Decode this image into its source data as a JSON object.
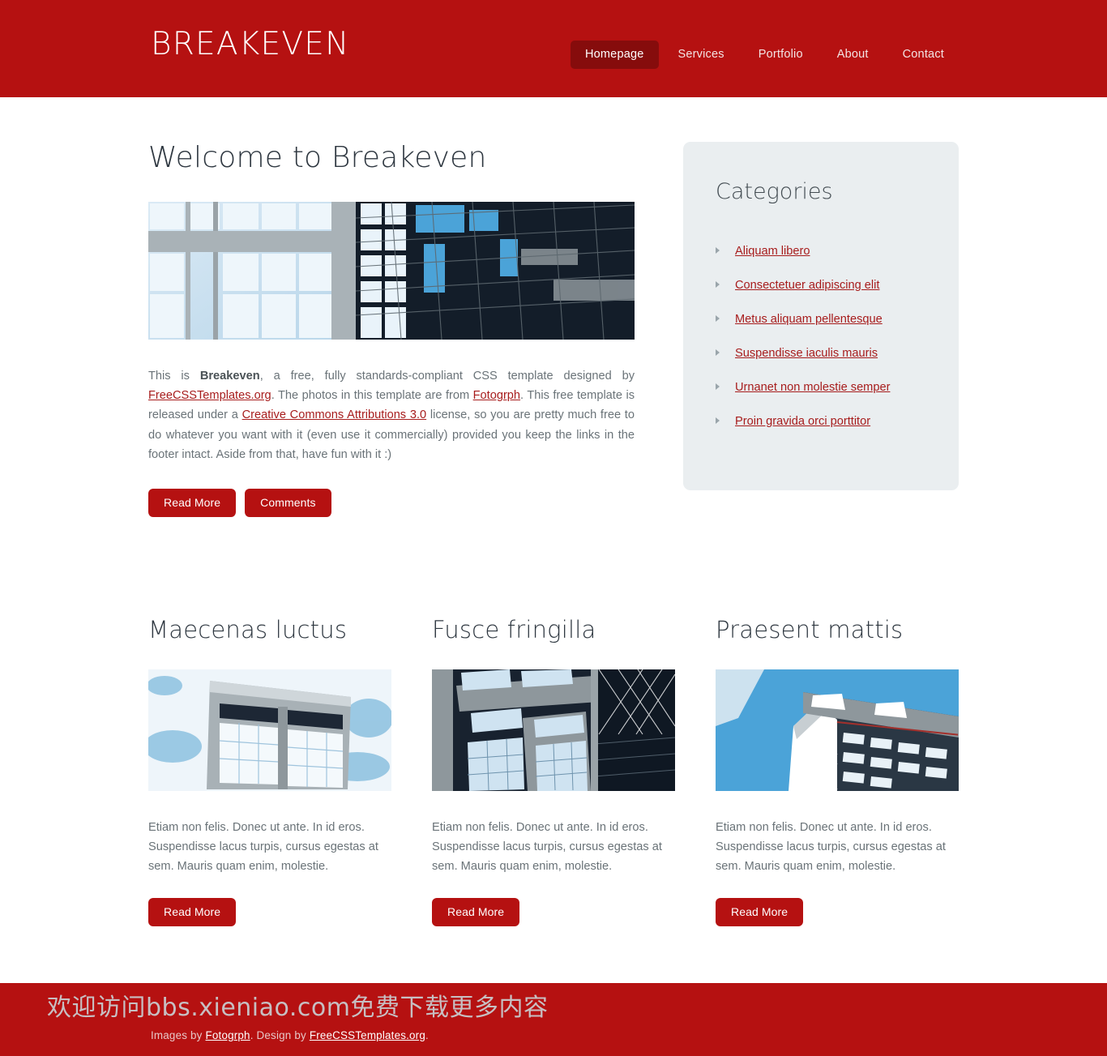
{
  "header": {
    "logo": "BREAKEVEN",
    "nav": [
      {
        "label": "Homepage",
        "active": true
      },
      {
        "label": "Services",
        "active": false
      },
      {
        "label": "Portfolio",
        "active": false
      },
      {
        "label": "About",
        "active": false
      },
      {
        "label": "Contact",
        "active": false
      }
    ]
  },
  "main": {
    "title": "Welcome to Breakeven",
    "paragraph": {
      "t1": "This is ",
      "b1": "Breakeven",
      "t2": ", a free, fully standards-compliant CSS template designed by ",
      "a1": "FreeCSSTemplates.org",
      "t3": ". The photos in this template are from ",
      "a2": "Fotogrph",
      "t4": ". This free template is released under a ",
      "a3": "Creative Commons Attributions 3.0",
      "t5": " license, so you are pretty much free to do whatever you want with it (even use it commercially) provided you keep the links in the footer intact. Aside from that, have fun with it :)"
    },
    "buttons": {
      "read_more": "Read More",
      "comments": "Comments"
    }
  },
  "sidebar": {
    "title": "Categories",
    "items": [
      {
        "label": "Aliquam libero"
      },
      {
        "label": "Consectetuer adipiscing elit"
      },
      {
        "label": "Metus aliquam pellentesque"
      },
      {
        "label": "Suspendisse iaculis mauris"
      },
      {
        "label": "Urnanet non molestie semper"
      },
      {
        "label": "Proin gravida orci porttitor"
      }
    ]
  },
  "columns": [
    {
      "title": "Maecenas luctus",
      "copy": "Etiam non felis. Donec ut ante. In id eros. Suspendisse lacus turpis, cursus egestas at sem. Mauris quam enim, molestie.",
      "button": "Read More"
    },
    {
      "title": "Fusce fringilla",
      "copy": "Etiam non felis. Donec ut ante. In id eros. Suspendisse lacus turpis, cursus egestas at sem. Mauris quam enim, molestie.",
      "button": "Read More"
    },
    {
      "title": "Praesent mattis",
      "copy": "Etiam non felis. Donec ut ante. In id eros. Suspendisse lacus turpis, cursus egestas at sem. Mauris quam enim, molestie.",
      "button": "Read More"
    }
  ],
  "footer": {
    "images_by_prefix": "Images by ",
    "images_by_link": "Fotogrph",
    "design_by_prefix": ". Design by ",
    "design_by_link": "FreeCSSTemplates.org",
    "suffix": "."
  },
  "watermark": {
    "text": "欢迎访问bbs.xieniao.com免费下载更多内容"
  },
  "colors": {
    "brand_red": "#b51111",
    "link_red": "#a71c1c",
    "panel_grey": "#eaeef0",
    "heading": "#2e3740"
  }
}
